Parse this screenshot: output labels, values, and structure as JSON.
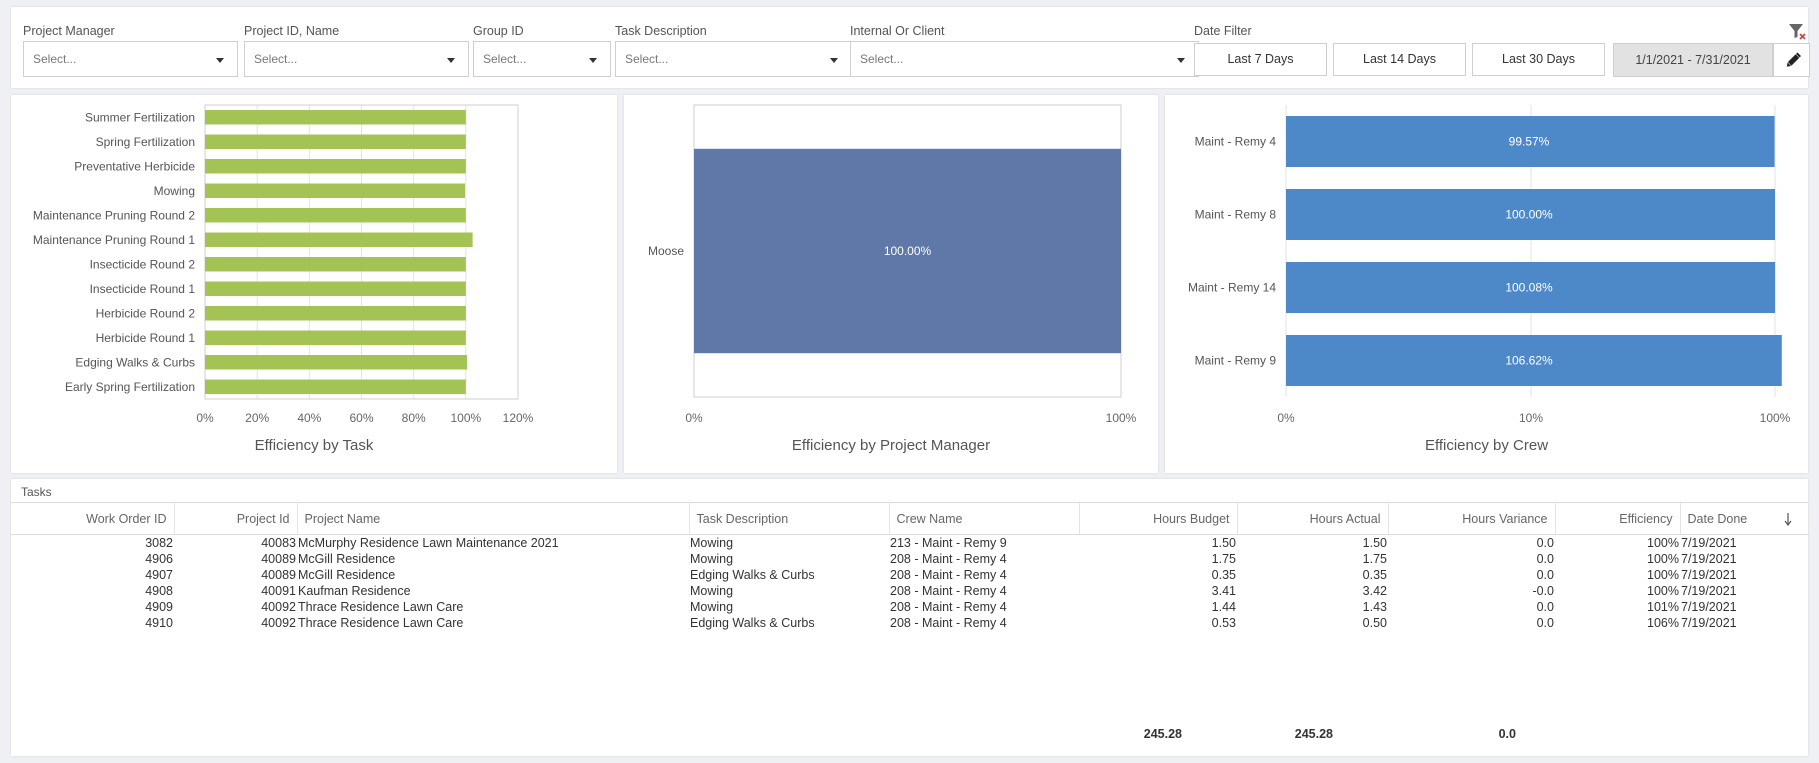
{
  "filters": {
    "project_manager": {
      "label": "Project Manager",
      "placeholder": "Select..."
    },
    "project_id_name": {
      "label": "Project ID, Name",
      "placeholder": "Select..."
    },
    "group_id": {
      "label": "Group ID",
      "placeholder": "Select..."
    },
    "task_description": {
      "label": "Task Description",
      "placeholder": "Select..."
    },
    "internal_or_client": {
      "label": "Internal Or Client",
      "placeholder": "Select..."
    },
    "date_filter": {
      "label": "Date Filter",
      "last7": "Last 7 Days",
      "last14": "Last 14 Days",
      "last30": "Last 30 Days",
      "range": "1/1/2021 - 7/31/2021"
    }
  },
  "icons": {
    "clear_filter": "filter-clear-icon",
    "edit": "pencil-icon",
    "dropdown": "caret-down-icon",
    "sort": "sort-down-arrow-icon"
  },
  "colors": {
    "task_bar": "#a3c455",
    "pm_bar": "#6078a8",
    "crew_bar": "#4d89c8"
  },
  "chart_data": [
    {
      "type": "bar",
      "orientation": "horizontal",
      "title": "Efficiency by Task",
      "categories": [
        "Summer Fertilization",
        "Spring Fertilization",
        "Preventative Herbicide",
        "Mowing",
        "Maintenance Pruning Round 2",
        "Maintenance Pruning Round 1",
        "Insecticide Round 2",
        "Insecticide Round 1",
        "Herbicide Round 2",
        "Herbicide Round 1",
        "Edging Walks & Curbs",
        "Early Spring Fertilization"
      ],
      "values": [
        100,
        100,
        100,
        99.7,
        100,
        102.6,
        100,
        100,
        100,
        100,
        100.5,
        100
      ],
      "xlim": [
        0,
        120
      ],
      "xticks": [
        "0%",
        "20%",
        "40%",
        "60%",
        "80%",
        "100%",
        "120%"
      ],
      "grid": true
    },
    {
      "type": "bar",
      "orientation": "horizontal",
      "title": "Efficiency by Project Manager",
      "categories": [
        "Moose"
      ],
      "values": [
        100
      ],
      "data_labels": [
        "100.00%"
      ],
      "xlim": [
        0,
        100
      ],
      "xticks": [
        "0%",
        "100%"
      ]
    },
    {
      "type": "bar",
      "orientation": "horizontal",
      "title": "Efficiency by Crew",
      "categories": [
        "Maint - Remy 4",
        "Maint - Remy 8",
        "Maint - Remy 14",
        "Maint - Remy 9"
      ],
      "values": [
        99.57,
        100.0,
        100.08,
        106.62
      ],
      "data_labels": [
        "99.57%",
        "100.00%",
        "100.08%",
        "106.62%"
      ],
      "xticks": [
        "0%",
        "10%",
        "100%"
      ],
      "scale": "log",
      "xlim": [
        1,
        110
      ]
    }
  ],
  "tasks": {
    "title": "Tasks",
    "columns": [
      "Work Order ID",
      "Project Id",
      "Project Name",
      "Task Description",
      "Crew Name",
      "Hours Budget",
      "Hours Actual",
      "Hours Variance",
      "Efficiency",
      "Date Done"
    ],
    "rows": [
      [
        "3082",
        "40083",
        "McMurphy Residence Lawn Maintenance 2021",
        "Mowing",
        "213 - Maint - Remy 9",
        "1.50",
        "1.50",
        "0.0",
        "100%",
        "7/19/2021"
      ],
      [
        "4906",
        "40089",
        "McGill Residence",
        "Mowing",
        "208 - Maint - Remy 4",
        "1.75",
        "1.75",
        "0.0",
        "100%",
        "7/19/2021"
      ],
      [
        "4907",
        "40089",
        "McGill Residence",
        "Edging Walks & Curbs",
        "208 - Maint - Remy 4",
        "0.35",
        "0.35",
        "0.0",
        "100%",
        "7/19/2021"
      ],
      [
        "4908",
        "40091",
        "Kaufman Residence",
        "Mowing",
        "208 - Maint - Remy 4",
        "3.41",
        "3.42",
        "-0.0",
        "100%",
        "7/19/2021"
      ],
      [
        "4909",
        "40092",
        "Thrace Residence Lawn Care",
        "Mowing",
        "208 - Maint - Remy 4",
        "1.44",
        "1.43",
        "0.0",
        "101%",
        "7/19/2021"
      ],
      [
        "4910",
        "40092",
        "Thrace Residence Lawn Care",
        "Edging Walks & Curbs",
        "208 - Maint - Remy 4",
        "0.53",
        "0.50",
        "0.0",
        "106%",
        "7/19/2021"
      ]
    ],
    "totals": {
      "hours_budget": "245.28",
      "hours_actual": "245.28",
      "hours_variance": "0.0"
    }
  }
}
